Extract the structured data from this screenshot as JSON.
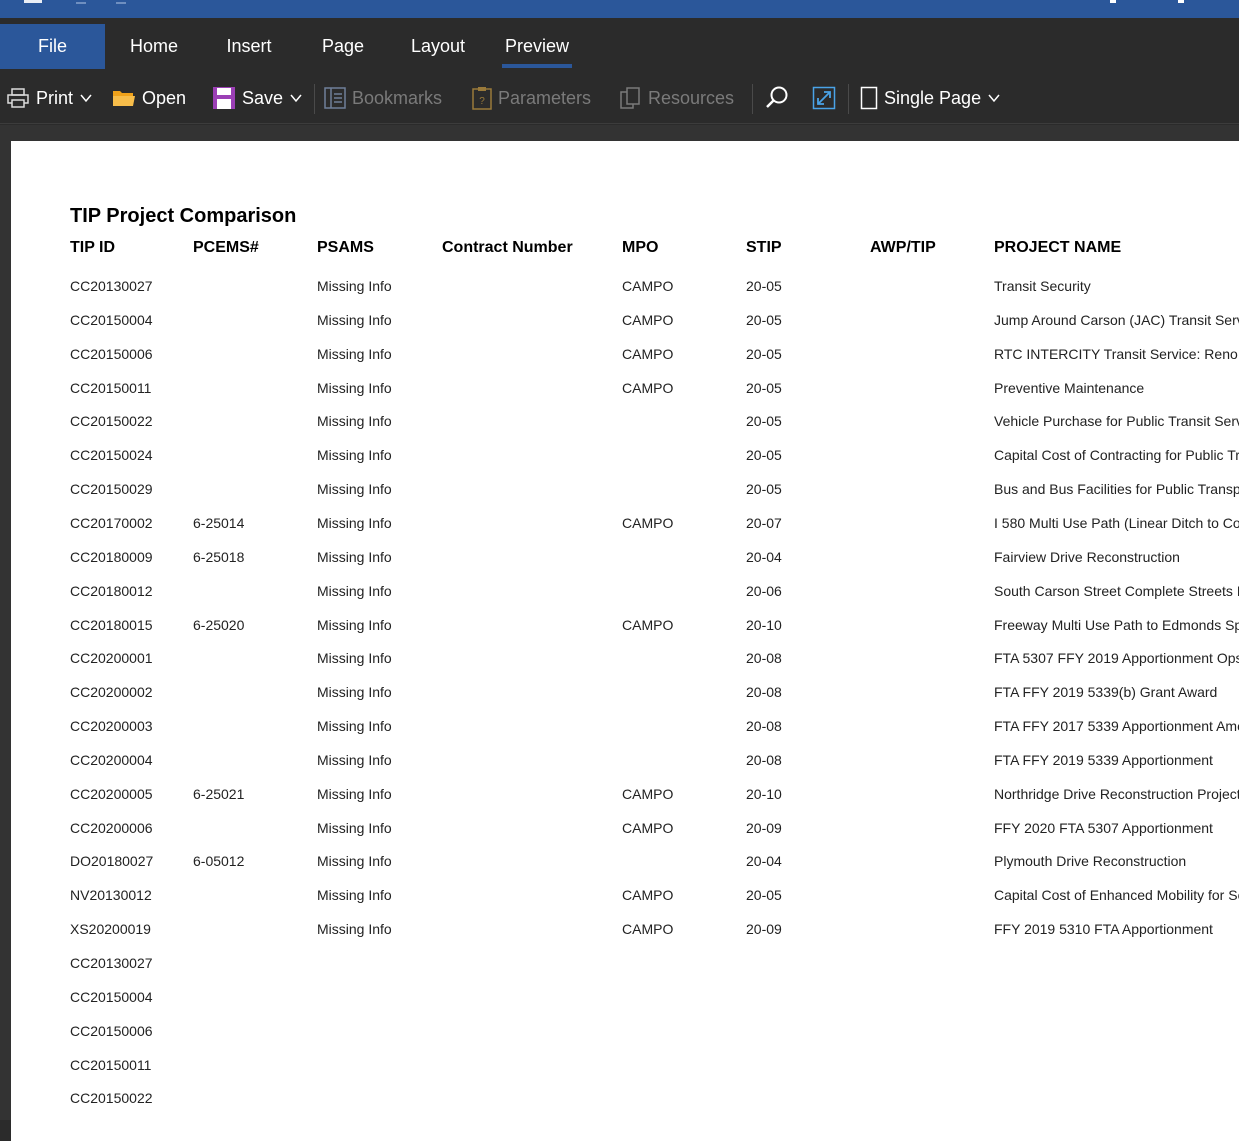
{
  "ribbon": {
    "tabs": [
      {
        "label": "File"
      },
      {
        "label": "Home"
      },
      {
        "label": "Insert"
      },
      {
        "label": "Page"
      },
      {
        "label": "Layout"
      },
      {
        "label": "Preview"
      }
    ],
    "active_tab": "Preview"
  },
  "toolbar": {
    "print_label": "Print",
    "open_label": "Open",
    "save_label": "Save",
    "bookmarks_label": "Bookmarks",
    "parameters_label": "Parameters",
    "resources_label": "Resources",
    "view_mode_label": "Single Page"
  },
  "colors": {
    "accent": "#2b579a",
    "toolbar_bg": "#2b2b2b",
    "save_icon": "#9b3fb5",
    "open_icon": "#f0a21a"
  },
  "report": {
    "title": "TIP Project Comparison",
    "columns": [
      "TIP ID",
      "PCEMS#",
      "PSAMS",
      "Contract Number",
      "MPO",
      "STIP",
      "AWP/TIP",
      "PROJECT NAME"
    ],
    "rows": [
      [
        "CC20130027",
        "",
        "Missing Info",
        "",
        "CAMPO",
        "20-05",
        "",
        "Transit Security"
      ],
      [
        "CC20150004",
        "",
        "Missing Info",
        "",
        "CAMPO",
        "20-05",
        "",
        "Jump Around Carson (JAC) Transit Serv"
      ],
      [
        "CC20150006",
        "",
        "Missing Info",
        "",
        "CAMPO",
        "20-05",
        "",
        "RTC INTERCITY Transit Service: Reno"
      ],
      [
        "CC20150011",
        "",
        "Missing Info",
        "",
        "CAMPO",
        "20-05",
        "",
        "Preventive Maintenance"
      ],
      [
        "CC20150022",
        "",
        "Missing Info",
        "",
        "",
        "20-05",
        "",
        "Vehicle Purchase for Public Transit Serv"
      ],
      [
        "CC20150024",
        "",
        "Missing Info",
        "",
        "",
        "20-05",
        "",
        "Capital Cost of Contracting for Public Tr"
      ],
      [
        "CC20150029",
        "",
        "Missing Info",
        "",
        "",
        "20-05",
        "",
        "Bus and Bus Facilities for Public Transp"
      ],
      [
        "CC20170002",
        "6-25014",
        "Missing Info",
        "",
        "CAMPO",
        "20-07",
        "",
        "I 580 Multi Use Path (Linear Ditch to Co"
      ],
      [
        "CC20180009",
        "6-25018",
        "Missing Info",
        "",
        "",
        "20-04",
        "",
        "Fairview Drive Reconstruction"
      ],
      [
        "CC20180012",
        "",
        "Missing Info",
        "",
        "",
        "20-06",
        "",
        "South Carson Street Complete Streets I"
      ],
      [
        "CC20180015",
        "6-25020",
        "Missing Info",
        "",
        "CAMPO",
        "20-10",
        "",
        "Freeway Multi Use Path to Edmonds Sp"
      ],
      [
        "CC20200001",
        "",
        "Missing Info",
        "",
        "",
        "20-08",
        "",
        "FTA 5307 FFY 2019 Apportionment Ops"
      ],
      [
        "CC20200002",
        "",
        "Missing Info",
        "",
        "",
        "20-08",
        "",
        "FTA FFY 2019 5339(b) Grant Award"
      ],
      [
        "CC20200003",
        "",
        "Missing Info",
        "",
        "",
        "20-08",
        "",
        "FTA FFY 2017 5339 Apportionment Ame"
      ],
      [
        "CC20200004",
        "",
        "Missing Info",
        "",
        "",
        "20-08",
        "",
        "FTA FFY 2019 5339 Apportionment"
      ],
      [
        "CC20200005",
        "6-25021",
        "Missing Info",
        "",
        "CAMPO",
        "20-10",
        "",
        "Northridge Drive Reconstruction Project"
      ],
      [
        "CC20200006",
        "",
        "Missing Info",
        "",
        "CAMPO",
        "20-09",
        "",
        "FFY 2020 FTA 5307 Apportionment"
      ],
      [
        "DO20180027",
        "6-05012",
        "Missing Info",
        "",
        "",
        "20-04",
        "",
        "Plymouth Drive Reconstruction"
      ],
      [
        "NV20130012",
        "",
        "Missing Info",
        "",
        "CAMPO",
        "20-05",
        "",
        "Capital Cost of Enhanced Mobility for Se"
      ],
      [
        "XS20200019",
        "",
        "Missing Info",
        "",
        "CAMPO",
        "20-09",
        "",
        "FFY 2019 5310 FTA Apportionment"
      ],
      [
        "CC20130027",
        "",
        "",
        "",
        "",
        "",
        "",
        ""
      ],
      [
        "CC20150004",
        "",
        "",
        "",
        "",
        "",
        "",
        ""
      ],
      [
        "CC20150006",
        "",
        "",
        "",
        "",
        "",
        "",
        ""
      ],
      [
        "CC20150011",
        "",
        "",
        "",
        "",
        "",
        "",
        ""
      ],
      [
        "CC20150022",
        "",
        "",
        "",
        "",
        "",
        "",
        ""
      ]
    ]
  }
}
